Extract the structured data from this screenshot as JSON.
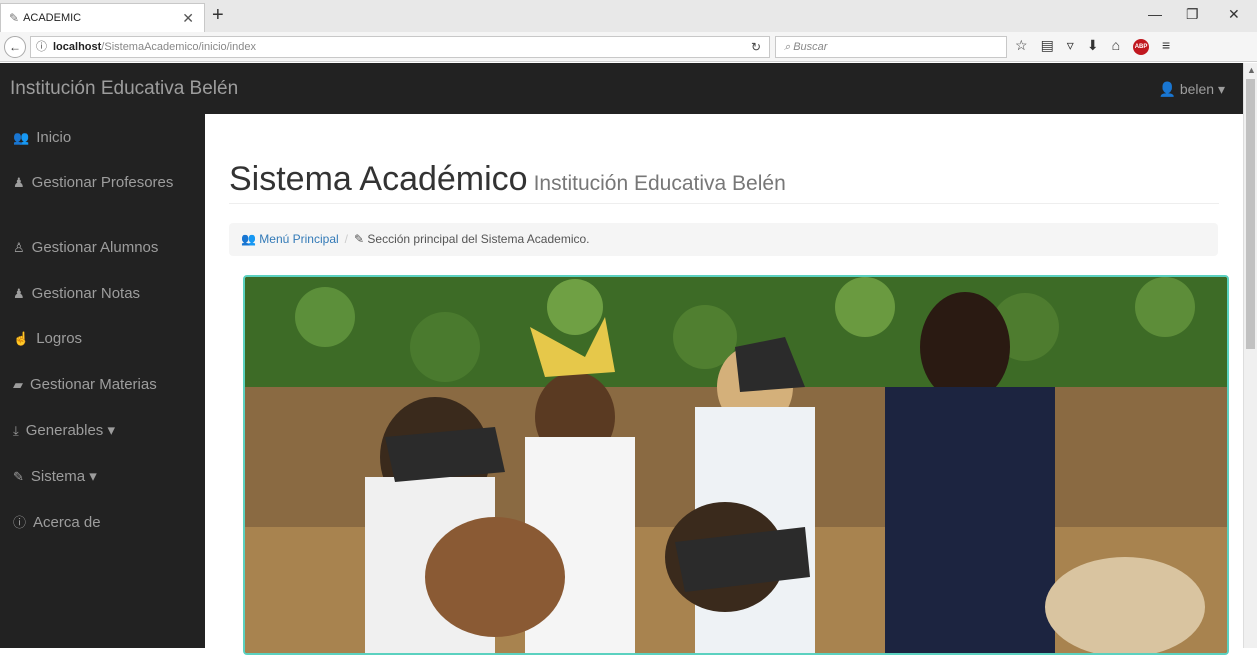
{
  "browser": {
    "tab_title": "ACADEMIC",
    "url_host": "localhost",
    "url_path": "/SistemaAcademico/inicio/index",
    "search_placeholder": "Buscar",
    "adblock_label": "ABP"
  },
  "header": {
    "brand": "Institución Educativa Belén",
    "user": "belen"
  },
  "sidebar": {
    "items": [
      {
        "label": "Inicio",
        "icon": "users-icon"
      },
      {
        "label": "Gestionar Profesores",
        "icon": "male-icon"
      },
      {
        "label": "Gestionar Alumnos",
        "icon": "child-icon"
      },
      {
        "label": "Gestionar Notas",
        "icon": "male-icon"
      },
      {
        "label": "Logros",
        "icon": "hand-icon"
      },
      {
        "label": "Gestionar Materias",
        "icon": "book-icon"
      },
      {
        "label": "Generables",
        "icon": "download-icon"
      },
      {
        "label": "Sistema",
        "icon": "edit-icon"
      },
      {
        "label": "Acerca de",
        "icon": "info-icon"
      }
    ]
  },
  "main": {
    "title": "Sistema Académico",
    "subtitle": "Institución Educativa Belén",
    "breadcrumb": {
      "link": "Menú Principal",
      "current": "Sección principal del Sistema Academico."
    }
  },
  "colors": {
    "header_bg": "#222222",
    "link": "#337ab7",
    "photo_border": "#5bd1c0"
  }
}
